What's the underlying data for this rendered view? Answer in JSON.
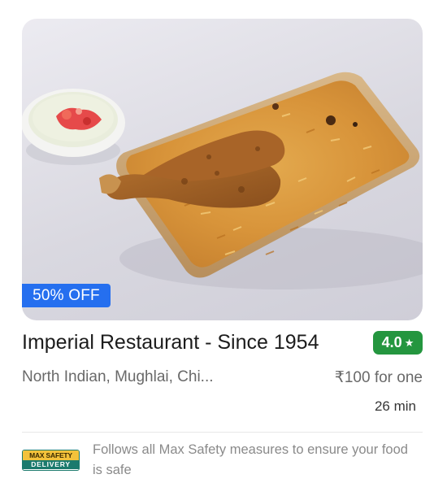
{
  "restaurant": {
    "name": "Imperial Restaurant - Since 1954",
    "rating": "4.0",
    "cuisines": "North Indian, Mughlai, Chi...",
    "price_for_one": "₹100 for one",
    "delivery_time": "26 min"
  },
  "offer": {
    "label": "50% OFF",
    "color": "#256fef"
  },
  "rating_color": "#24963f",
  "safety": {
    "logo_top": "MAX SAFETY",
    "logo_bottom": "DELIVERY",
    "text": "Follows all Max Safety measures to ensure your food is safe"
  },
  "icons": {
    "rating": "star-icon",
    "safety": "max-safety-delivery-logo"
  }
}
